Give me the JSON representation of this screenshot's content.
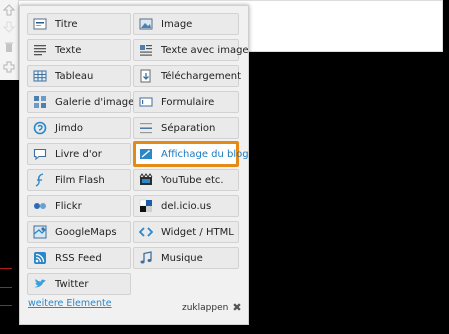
{
  "panel": {
    "items": [
      {
        "label": "Titre",
        "icon": "title-icon"
      },
      {
        "label": "Image",
        "icon": "image-icon"
      },
      {
        "label": "Texte",
        "icon": "text-icon"
      },
      {
        "label": "Texte avec image",
        "icon": "text-with-image-icon"
      },
      {
        "label": "Tableau",
        "icon": "table-icon"
      },
      {
        "label": "Téléchargement",
        "icon": "download-icon"
      },
      {
        "label": "Galerie d'images",
        "icon": "gallery-icon"
      },
      {
        "label": "Formulaire",
        "icon": "form-icon"
      },
      {
        "label": "Jimdo",
        "icon": "jimdo-icon"
      },
      {
        "label": "Séparation",
        "icon": "separator-icon"
      },
      {
        "label": "Livre d'or",
        "icon": "guestbook-icon"
      },
      {
        "label": "Affichage du blog",
        "icon": "blog-icon"
      },
      {
        "label": "Film Flash",
        "icon": "flash-icon"
      },
      {
        "label": "YouTube etc.",
        "icon": "video-icon"
      },
      {
        "label": "Flickr",
        "icon": "flickr-icon"
      },
      {
        "label": "del.icio.us",
        "icon": "delicious-icon"
      },
      {
        "label": "GoogleMaps",
        "icon": "map-icon"
      },
      {
        "label": "Widget / HTML",
        "icon": "code-icon"
      },
      {
        "label": "RSS Feed",
        "icon": "rss-icon"
      },
      {
        "label": "Musique",
        "icon": "music-icon"
      },
      {
        "label": "Twitter",
        "icon": "twitter-icon"
      }
    ],
    "selected": "Affichage du blog",
    "more_link": "weitere Elemente",
    "close_label": "zuklappen",
    "close_symbol": "✖"
  },
  "colors": {
    "accent_border": "#e68a17",
    "link": "#2a87c8",
    "selected_text": "#1a7bbf"
  }
}
